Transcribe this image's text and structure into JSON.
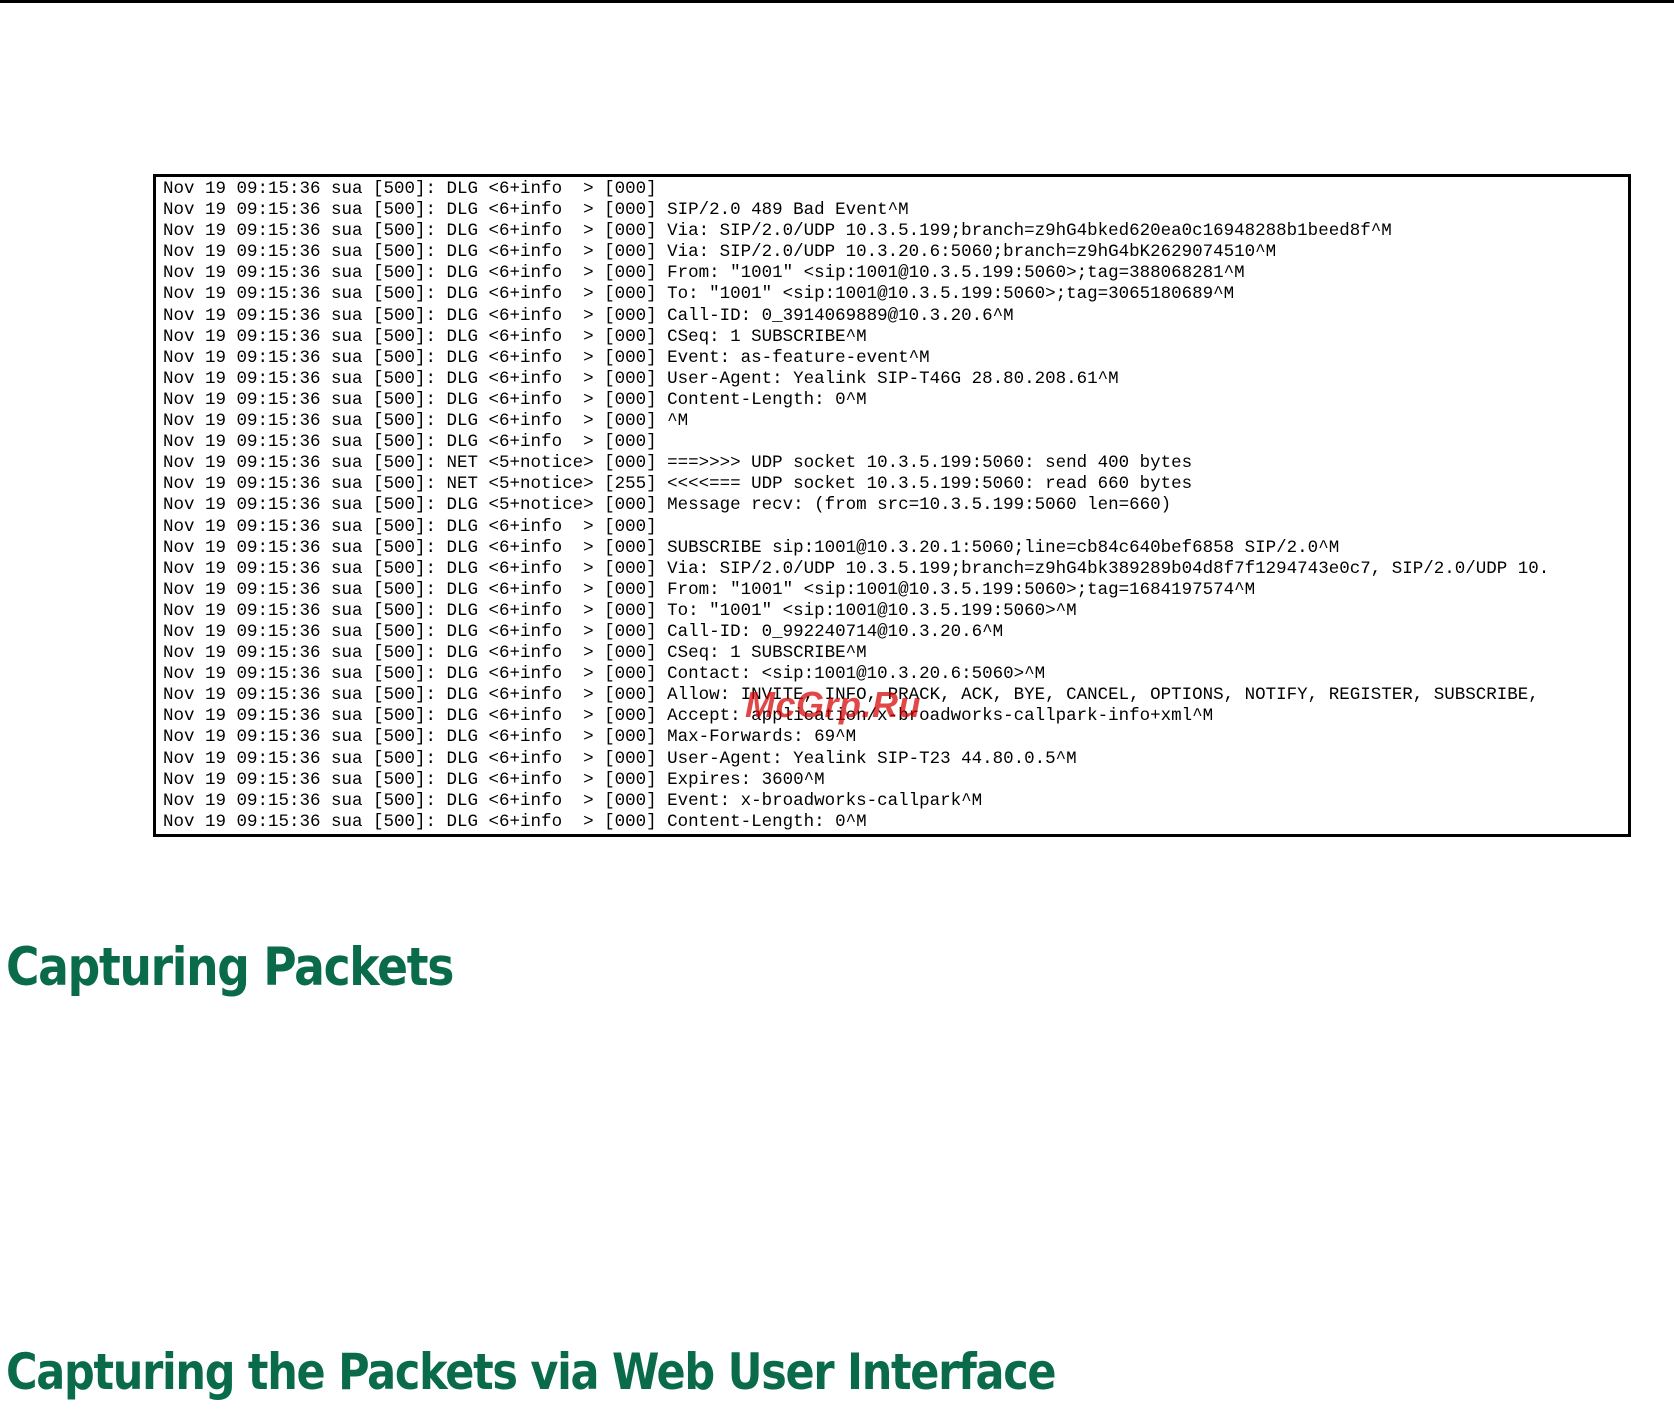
{
  "log": {
    "lines": [
      "Nov 19 09:15:36 sua [500]: DLG <6+info  > [000]",
      "Nov 19 09:15:36 sua [500]: DLG <6+info  > [000] SIP/2.0 489 Bad Event^M",
      "Nov 19 09:15:36 sua [500]: DLG <6+info  > [000] Via: SIP/2.0/UDP 10.3.5.199;branch=z9hG4bked620ea0c16948288b1beed8f^M",
      "Nov 19 09:15:36 sua [500]: DLG <6+info  > [000] Via: SIP/2.0/UDP 10.3.20.6:5060;branch=z9hG4bK2629074510^M",
      "Nov 19 09:15:36 sua [500]: DLG <6+info  > [000] From: \"1001\" <sip:1001@10.3.5.199:5060>;tag=388068281^M",
      "Nov 19 09:15:36 sua [500]: DLG <6+info  > [000] To: \"1001\" <sip:1001@10.3.5.199:5060>;tag=3065180689^M",
      "Nov 19 09:15:36 sua [500]: DLG <6+info  > [000] Call-ID: 0_3914069889@10.3.20.6^M",
      "Nov 19 09:15:36 sua [500]: DLG <6+info  > [000] CSeq: 1 SUBSCRIBE^M",
      "Nov 19 09:15:36 sua [500]: DLG <6+info  > [000] Event: as-feature-event^M",
      "Nov 19 09:15:36 sua [500]: DLG <6+info  > [000] User-Agent: Yealink SIP-T46G 28.80.208.61^M",
      "Nov 19 09:15:36 sua [500]: DLG <6+info  > [000] Content-Length: 0^M",
      "Nov 19 09:15:36 sua [500]: DLG <6+info  > [000] ^M",
      "Nov 19 09:15:36 sua [500]: DLG <6+info  > [000]",
      "Nov 19 09:15:36 sua [500]: NET <5+notice> [000] ===>>>> UDP socket 10.3.5.199:5060: send 400 bytes",
      "Nov 19 09:15:36 sua [500]: NET <5+notice> [255] <<<<=== UDP socket 10.3.5.199:5060: read 660 bytes",
      "Nov 19 09:15:36 sua [500]: DLG <5+notice> [000] Message recv: (from src=10.3.5.199:5060 len=660)",
      "Nov 19 09:15:36 sua [500]: DLG <6+info  > [000]",
      "Nov 19 09:15:36 sua [500]: DLG <6+info  > [000] SUBSCRIBE sip:1001@10.3.20.1:5060;line=cb84c640bef6858 SIP/2.0^M",
      "Nov 19 09:15:36 sua [500]: DLG <6+info  > [000] Via: SIP/2.0/UDP 10.3.5.199;branch=z9hG4bk389289b04d8f7f1294743e0c7, SIP/2.0/UDP 10.",
      "Nov 19 09:15:36 sua [500]: DLG <6+info  > [000] From: \"1001\" <sip:1001@10.3.5.199:5060>;tag=1684197574^M",
      "Nov 19 09:15:36 sua [500]: DLG <6+info  > [000] To: \"1001\" <sip:1001@10.3.5.199:5060>^M",
      "Nov 19 09:15:36 sua [500]: DLG <6+info  > [000] Call-ID: 0_992240714@10.3.20.6^M",
      "Nov 19 09:15:36 sua [500]: DLG <6+info  > [000] CSeq: 1 SUBSCRIBE^M",
      "Nov 19 09:15:36 sua [500]: DLG <6+info  > [000] Contact: <sip:1001@10.3.20.6:5060>^M",
      "Nov 19 09:15:36 sua [500]: DLG <6+info  > [000] Allow: INVITE, INFO, PRACK, ACK, BYE, CANCEL, OPTIONS, NOTIFY, REGISTER, SUBSCRIBE,",
      "Nov 19 09:15:36 sua [500]: DLG <6+info  > [000] Accept: application/x-broadworks-callpark-info+xml^M",
      "Nov 19 09:15:36 sua [500]: DLG <6+info  > [000] Max-Forwards: 69^M",
      "Nov 19 09:15:36 sua [500]: DLG <6+info  > [000] User-Agent: Yealink SIP-T23 44.80.0.5^M",
      "Nov 19 09:15:36 sua [500]: DLG <6+info  > [000] Expires: 3600^M",
      "Nov 19 09:15:36 sua [500]: DLG <6+info  > [000] Event: x-broadworks-callpark^M",
      "Nov 19 09:15:36 sua [500]: DLG <6+info  > [000] Content-Length: 0^M"
    ]
  },
  "watermark": "McGrp.Ru",
  "headings": {
    "section": "Capturing Packets",
    "subsection": "Capturing the Packets via Web User Interface"
  },
  "colors": {
    "heading": "#0a6b4a",
    "watermark": "#d60000",
    "border": "#000000"
  }
}
